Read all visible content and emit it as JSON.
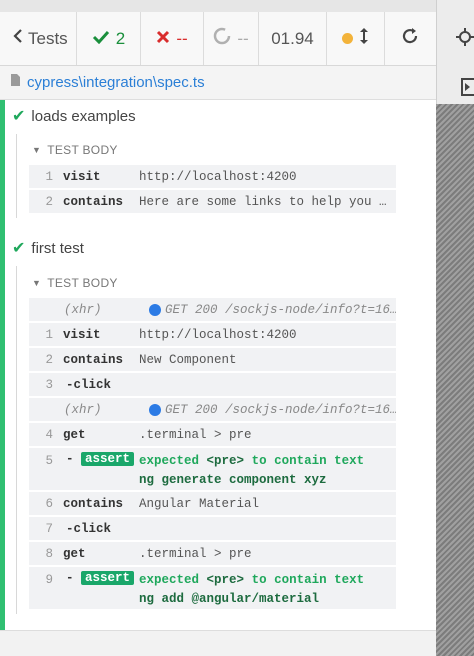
{
  "header": {
    "back_label": "Tests",
    "passed": "2",
    "failed": "--",
    "pending": "--",
    "duration": "01.94"
  },
  "spec": {
    "path": "cypress\\integration\\spec.ts"
  },
  "tests": [
    {
      "title": "loads examples",
      "section": "TEST BODY",
      "commands": [
        {
          "num": "1",
          "name": "visit",
          "message": "http://localhost:4200"
        },
        {
          "num": "2",
          "name": "contains",
          "message": "Here are some links to help you …"
        }
      ]
    },
    {
      "title": "first test",
      "section": "TEST BODY",
      "commands": [
        {
          "num": "",
          "name": "(xhr)",
          "message": "GET 200 /sockjs-node/info?t=16…"
        },
        {
          "num": "1",
          "name": "visit",
          "message": "http://localhost:4200"
        },
        {
          "num": "2",
          "name": "contains",
          "message": "New Component"
        },
        {
          "num": "3",
          "name": "-click",
          "message": ""
        },
        {
          "num": "",
          "name": "(xhr)",
          "message": "GET 200 /sockjs-node/info?t=16…"
        },
        {
          "num": "4",
          "name": "get",
          "message": ".terminal > pre"
        },
        {
          "num": "5",
          "name": "assert",
          "message_prefix": "expected",
          "message_el": "<pre>",
          "message_mid": "to contain text",
          "message_text": "ng generate component xyz"
        },
        {
          "num": "6",
          "name": "contains",
          "message": "Angular Material"
        },
        {
          "num": "7",
          "name": "-click",
          "message": ""
        },
        {
          "num": "8",
          "name": "get",
          "message": ".terminal > pre"
        },
        {
          "num": "9",
          "name": "assert",
          "message_prefix": "expected",
          "message_el": "<pre>",
          "message_mid": "to contain text",
          "message_text": "ng add @angular/material"
        }
      ]
    }
  ],
  "colors": {
    "pass": "#1fa85c",
    "fail": "#d92d2d",
    "link": "#2b7fd6",
    "running": "#f3b33a"
  }
}
